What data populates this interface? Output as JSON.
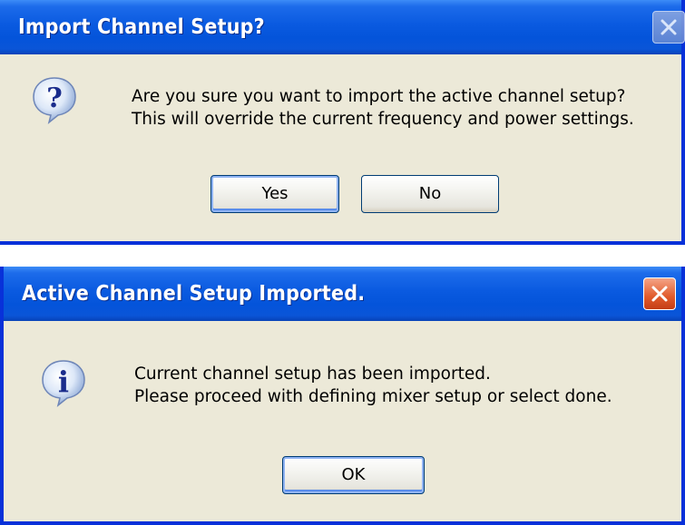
{
  "dialogs": [
    {
      "title": "Import Channel Setup?",
      "icon": "question-icon",
      "message_lines": [
        "Are you sure you want to import the active channel setup?",
        "This will override the current frequency and power settings."
      ],
      "buttons": [
        "Yes",
        "No"
      ]
    },
    {
      "title": "Active Channel Setup Imported.",
      "icon": "info-icon",
      "message_lines": [
        "Current channel setup has been imported.",
        "Please proceed with defining mixer setup or select done."
      ],
      "buttons": [
        "OK"
      ]
    }
  ],
  "colors": {
    "titlebar": "#0A5AE0",
    "window_border": "#0831D9",
    "dialog_background": "#ECE9D8",
    "close_active": "#E05A2B",
    "close_inactive": "#8FA9E0"
  }
}
